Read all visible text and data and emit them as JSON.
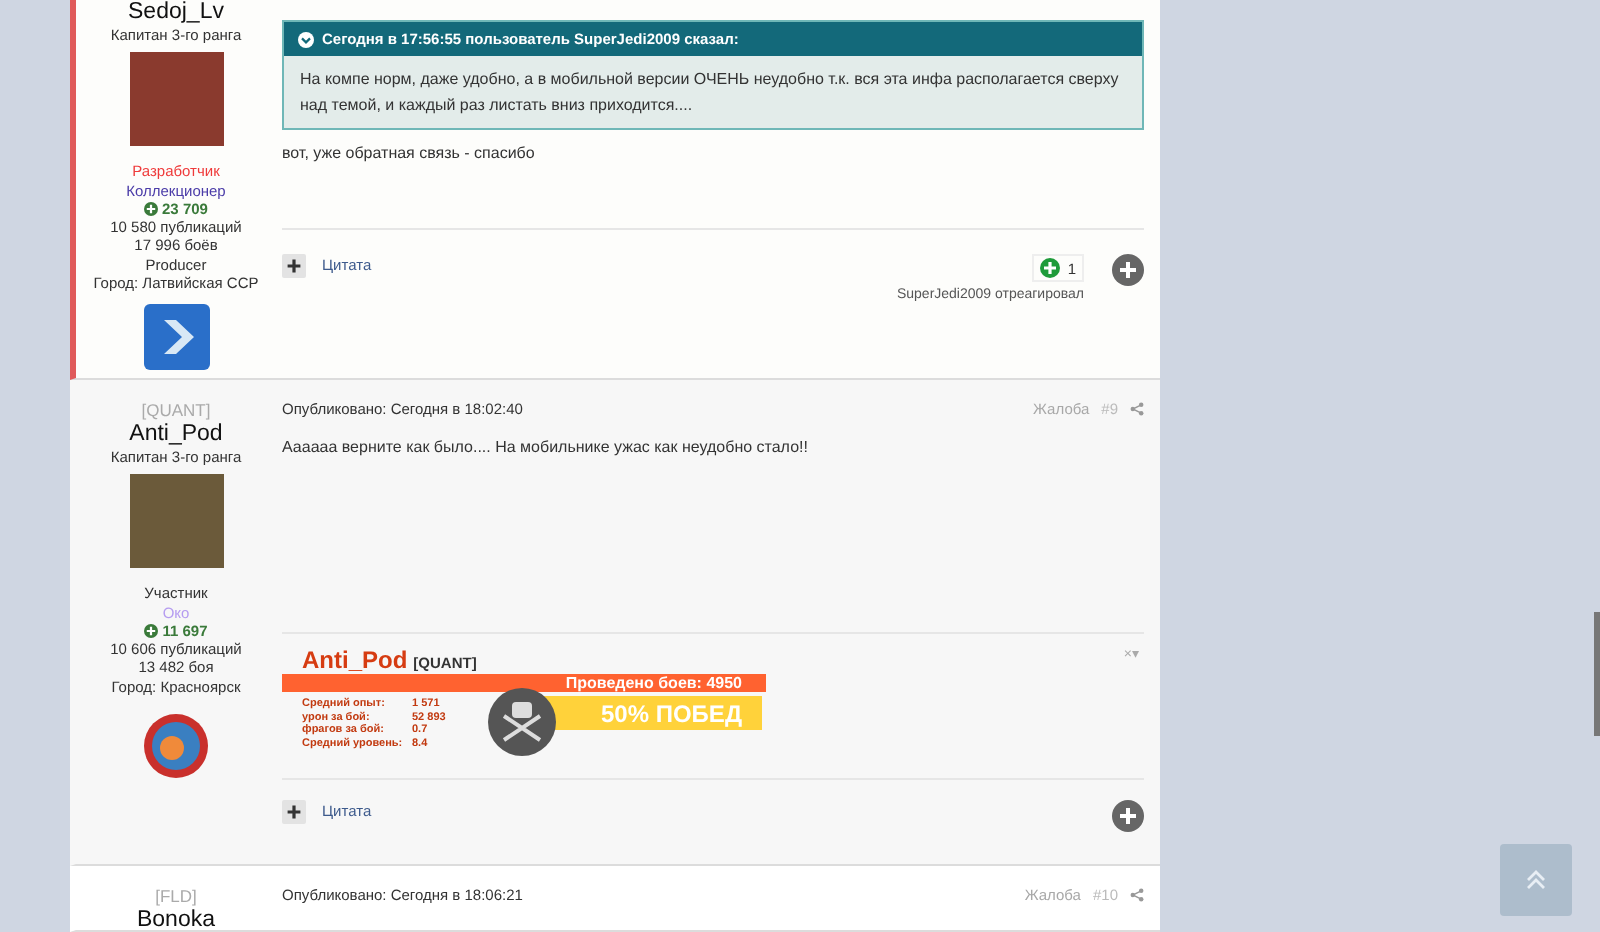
{
  "posts": [
    {
      "author": {
        "name": "Sedoj_Lv",
        "rank": "Капитан 3-го ранга",
        "roles": [
          {
            "text": "Разработчик",
            "color": "#ef3b3b"
          },
          {
            "text": "Коллекционер",
            "color": "#4b3ca8"
          }
        ],
        "reputation": "23 709",
        "posts_count": "10 580 публикаций",
        "battles": "17 996 боёв",
        "extra": "Producer",
        "city": "Город: Латвийская ССР"
      },
      "highlighted": true,
      "quote": {
        "header": "Сегодня в 17:56:55 пользователь SuperJedi2009 сказал:",
        "text": "На компе норм, даже удобно, а в мобильной версии ОЧЕНЬ неудобно т.к. вся эта инфа располагается сверху над темой, и каждый раз листать вниз приходится...."
      },
      "body": "вот, уже обратная связь - спасибо",
      "quote_label": "Цитата",
      "reactions": {
        "count": "1",
        "by": "SuperJedi2009 отреагировал"
      }
    },
    {
      "author": {
        "clan": "[QUANT]",
        "name": "Anti_Pod",
        "rank": "Капитан 3-го ранга",
        "roles": [
          {
            "text": "Участник",
            "color": "#333333"
          },
          {
            "text": "Око",
            "color": "#b59cf0"
          }
        ],
        "reputation": "11 697",
        "posts_count": "10 606 публикаций",
        "battles": "13 482 боя",
        "city": "Город: Красноярск"
      },
      "highlighted": false,
      "published": "Опубликовано: Сегодня в 18:02:40",
      "report": "Жалоба",
      "number": "#9",
      "body": "Аааааа верните как было.... На мобильнике ужас как неудобно стало!!",
      "signature": {
        "name": "Anti_Pod",
        "clan": "[QUANT]",
        "battles": "Проведено боев: 4950",
        "winrate": "50% ПОБЕД",
        "close": "×▾",
        "stats": [
          {
            "label": "Средний опыт:",
            "value": "1 571"
          },
          {
            "label": "урон за бой:",
            "value": "52 893"
          },
          {
            "label": "фрагов за бой:",
            "value": "0.7"
          },
          {
            "label": "Средний уровень:",
            "value": "8.4"
          }
        ]
      },
      "quote_label": "Цитата"
    },
    {
      "author": {
        "clan": "[FLD]",
        "name": "Bonoka"
      },
      "highlighted": false,
      "published": "Опубликовано: Сегодня в 18:06:21",
      "report": "Жалоба",
      "number": "#10"
    }
  ]
}
